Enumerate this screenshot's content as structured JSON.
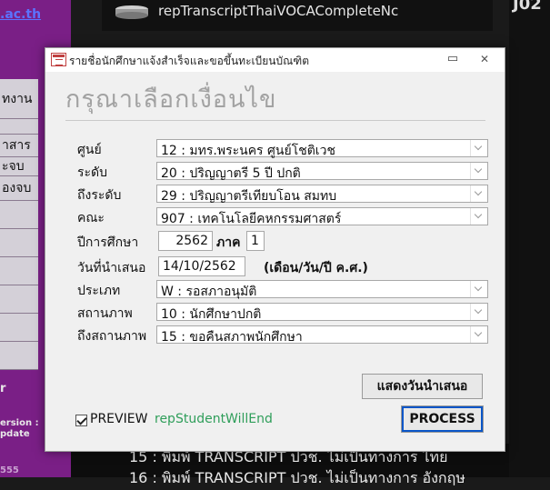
{
  "background": {
    "link_text": ".ac.th",
    "app_title": "repTranscriptThaiVOCACompleteNc",
    "right_text": "J02",
    "nav_items": [
      "ทงาน",
      "",
      "าสาร",
      "ะจบ",
      "องจบ",
      "",
      "",
      "",
      "",
      "",
      ""
    ],
    "version_lines": [
      "ersion :",
      "pdate"
    ],
    "bottom_lines": [
      "15 : พิมพ์ TRANSCRIPT ปวช. ไม่เป็นทางการ ไทย",
      "16 : พิมพ์ TRANSCRIPT ปวช. ไม่เป็นทางการ อังกฤษ"
    ],
    "left_small": "555",
    "left_mid": "r"
  },
  "dialog": {
    "title": "รายชื่อนักศึกษาแจ้งสำเร็จและขอขึ้นทะเบียนบัณฑิต",
    "min_glyph": "▭",
    "close_glyph": "✕",
    "heading": "กรุณาเลือกเงื่อนไข",
    "fields": {
      "center": {
        "label": "ศูนย์",
        "value": "12 : มทร.พระนคร ศูนย์โชติเวช"
      },
      "level": {
        "label": "ระดับ",
        "value": "20 : ปริญญาตรี 5 ปี ปกติ"
      },
      "to_level": {
        "label": "ถึงระดับ",
        "value": "29 : ปริญญาตรีเทียบโอน สมทบ"
      },
      "faculty": {
        "label": "คณะ",
        "value": "907 : เทคโนโลยีคหกรรมศาสตร์"
      },
      "academic_year": {
        "label": "ปีการศึกษา",
        "value": "2562",
        "term_label": "ภาค",
        "term_value": "1"
      },
      "present_date": {
        "label": "วันที่นำเสนอ",
        "value": "14/10/2562",
        "hint": "(เดือน/วัน/ปี ค.ศ.)"
      },
      "type": {
        "label": "ประเภท",
        "value": "W : รอสภาอนุมัติ"
      },
      "status": {
        "label": "สถานภาพ",
        "value": "10 : นักศึกษาปกติ"
      },
      "to_status": {
        "label": "ถึงสถานภาพ",
        "value": "15 : ขอคืนสภาพนักศึกษา"
      }
    },
    "show_date_button": "แสดงวันนำเสนอ",
    "preview_label": "PREVIEW",
    "preview_checked": true,
    "form_name": "repStudentWillEnd",
    "process_button": "PROCESS"
  }
}
